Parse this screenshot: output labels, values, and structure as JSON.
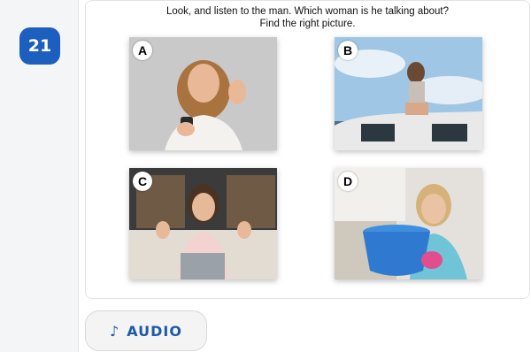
{
  "question": {
    "number": "21",
    "line1": "Look, and listen to the man. Which woman is he talking about?",
    "line2": "Find the right picture."
  },
  "options": [
    {
      "letter": "A"
    },
    {
      "letter": "B"
    },
    {
      "letter": "C"
    },
    {
      "letter": "D"
    }
  ],
  "audio": {
    "icon": "music-note-icon",
    "glyph": "♪",
    "label": "AUDIO"
  },
  "colors": {
    "accent": "#1d5fbf",
    "audio_text": "#1e5aa8"
  }
}
